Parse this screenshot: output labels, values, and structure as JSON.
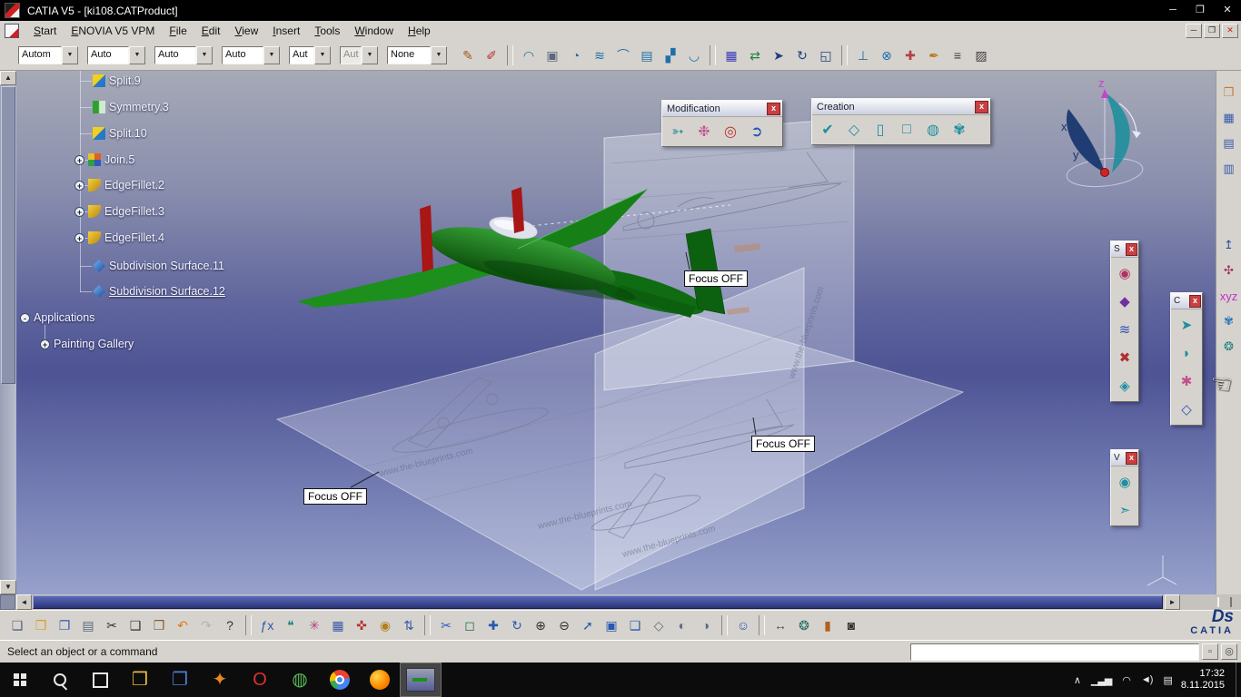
{
  "titlebar": {
    "title": "CATIA V5 - [ki108.CATProduct]",
    "minimize": "─",
    "restore": "❒",
    "close": "✕"
  },
  "menubar": {
    "items": [
      {
        "label": "Start"
      },
      {
        "label": "ENOVIA V5 VPM"
      },
      {
        "label": "File"
      },
      {
        "label": "Edit"
      },
      {
        "label": "View"
      },
      {
        "label": "Insert"
      },
      {
        "label": "Tools"
      },
      {
        "label": "Window"
      },
      {
        "label": "Help"
      }
    ],
    "minimize": "─",
    "restore": "❒",
    "close": "✕"
  },
  "filter_toolbar": {
    "dropdown_glyph": "▼",
    "combos": [
      {
        "value": "Autom"
      },
      {
        "value": "Auto"
      },
      {
        "value": "Auto"
      },
      {
        "value": "Auto"
      },
      {
        "value": "Aut"
      },
      {
        "value": "Aut"
      },
      {
        "value": "None"
      }
    ],
    "icons": [
      {
        "name": "paintbrush-icon",
        "glyph": "✎",
        "color": "#a05818"
      },
      {
        "name": "spray-brush-icon",
        "glyph": "✐",
        "color": "#b83030"
      },
      {
        "sep": true
      },
      {
        "name": "arc-curve-icon",
        "glyph": "◠",
        "color": "#1f6fa8"
      },
      {
        "name": "isometric-box-icon",
        "glyph": "▣",
        "color": "#5a6a7a"
      },
      {
        "name": "revolve-surface-icon",
        "glyph": "◔",
        "color": "#1f6fa8"
      },
      {
        "name": "offset-surface-icon",
        "glyph": "≋",
        "color": "#1f6fa8"
      },
      {
        "name": "sweep-surface-icon",
        "glyph": "⌒",
        "color": "#1f6fa8"
      },
      {
        "name": "fill-surface-icon",
        "glyph": "▤",
        "color": "#1f6fa8"
      },
      {
        "name": "loft-surface-icon",
        "glyph": "▞",
        "color": "#1f6fa8"
      },
      {
        "name": "blend-surface-icon",
        "glyph": "◡",
        "color": "#1f6fa8"
      },
      {
        "sep": true
      },
      {
        "name": "uv-grid-icon",
        "glyph": "▦",
        "color": "#3a3ab8"
      },
      {
        "name": "symmetry-transform-icon",
        "glyph": "⇄",
        "color": "#1f8040"
      },
      {
        "name": "translate-icon",
        "glyph": "➤",
        "color": "#20407f"
      },
      {
        "name": "rotate-icon",
        "glyph": "↻",
        "color": "#20407f"
      },
      {
        "name": "scale-icon",
        "glyph": "◱",
        "color": "#20407f"
      },
      {
        "sep": true
      },
      {
        "name": "projection-icon",
        "glyph": "⊥",
        "color": "#1f6fa8"
      },
      {
        "name": "intersection-icon",
        "glyph": "⊗",
        "color": "#1f6fa8"
      },
      {
        "name": "healing-icon",
        "glyph": "✚",
        "color": "#b84040"
      },
      {
        "name": "pen-icon",
        "glyph": "✒",
        "color": "#b87818"
      },
      {
        "name": "stacking-icon",
        "glyph": "≡",
        "color": "#404040"
      },
      {
        "name": "hatching-icon",
        "glyph": "▨",
        "color": "#404040"
      }
    ]
  },
  "tree": {
    "items": [
      {
        "label": "Split.9"
      },
      {
        "label": "Symmetry.3"
      },
      {
        "label": "Split.10"
      },
      {
        "label": "Join.5",
        "expander": "+"
      },
      {
        "label": "EdgeFillet.2",
        "expander": "+"
      },
      {
        "label": "EdgeFillet.3",
        "expander": "+"
      },
      {
        "label": "EdgeFillet.4",
        "expander": "+"
      },
      {
        "label": "Subdivision Surface.11"
      },
      {
        "label": "Subdivision Surface.12"
      },
      {
        "label": "Applications",
        "expander": "-"
      },
      {
        "label": "Painting Gallery",
        "expander": "+"
      }
    ]
  },
  "viewport": {
    "focus_off_labels": [
      "Focus OFF",
      "Focus OFF",
      "Focus OFF"
    ],
    "watermark": "www.the-blueprints.com",
    "compass": {
      "x": "x",
      "y": "y",
      "z": "z"
    }
  },
  "panels": {
    "modification": {
      "title": "Modification",
      "close_label": "x",
      "icons": [
        {
          "name": "modification-curve-icon",
          "glyph": "➳",
          "color": "#1f8f9f"
        },
        {
          "name": "attraction-icon",
          "glyph": "❉",
          "color": "#c05090"
        },
        {
          "name": "erase-icon",
          "glyph": "◎",
          "color": "#c03030"
        },
        {
          "name": "revert-icon",
          "glyph": "➲",
          "color": "#2858b0"
        }
      ]
    },
    "creation": {
      "title": "Creation",
      "close_label": "x",
      "icons": [
        {
          "name": "create-curve-icon",
          "glyph": "✔",
          "color": "#1f8f9f"
        },
        {
          "name": "create-surface-icon",
          "glyph": "◇",
          "color": "#1f8f9f"
        },
        {
          "name": "create-cylinder-icon",
          "glyph": "▯",
          "color": "#1f8f9f"
        },
        {
          "name": "create-box-icon",
          "glyph": "□",
          "color": "#1f8f9f"
        },
        {
          "name": "create-sphere-icon",
          "glyph": "◍",
          "color": "#1f8f9f"
        },
        {
          "name": "create-swirl-icon",
          "glyph": "✾",
          "color": "#1f8f9f"
        }
      ]
    },
    "s_toolbar": {
      "title": "S",
      "close_label": "x",
      "icons": [
        {
          "name": "subdivision-sphere-icon",
          "glyph": "◉",
          "color": "#b03060"
        },
        {
          "name": "subdivision-cube-icon",
          "glyph": "◆",
          "color": "#7030a0"
        },
        {
          "name": "subdivision-pipe-icon",
          "glyph": "≋",
          "color": "#3050b0"
        },
        {
          "name": "subdivision-cut-icon",
          "glyph": "✖",
          "color": "#b03030"
        },
        {
          "name": "subdivision-box-icon",
          "glyph": "◈",
          "color": "#1f8f9f"
        }
      ]
    },
    "c_toolbar": {
      "title": "C",
      "close_label": "x",
      "icons": [
        {
          "name": "curve-edit-icon",
          "glyph": "➤",
          "color": "#1f8f9f"
        },
        {
          "name": "surface-edit-icon",
          "glyph": "◗",
          "color": "#1f8f9f"
        },
        {
          "name": "control-points-icon",
          "glyph": "✱",
          "color": "#c05090"
        },
        {
          "name": "cage-icon",
          "glyph": "◇",
          "color": "#3050b0"
        }
      ]
    },
    "v_toolbar": {
      "title": "V",
      "close_label": "x",
      "icons": [
        {
          "name": "visualization-eye-icon",
          "glyph": "◉",
          "color": "#1f8f9f"
        },
        {
          "name": "visualization-arrow-icon",
          "glyph": "➣",
          "color": "#1f8f9f"
        }
      ]
    }
  },
  "right_dock": {
    "icons": [
      {
        "name": "catalog-icon",
        "glyph": "❒",
        "color": "#c87830"
      },
      {
        "name": "design-table-icon",
        "glyph": "▦",
        "color": "#3858a8"
      },
      {
        "name": "spreadsheet-icon",
        "glyph": "▤",
        "color": "#3858a8"
      },
      {
        "name": "report-icon",
        "glyph": "▥",
        "color": "#3858a8"
      },
      {
        "name": "exit-workbench-icon",
        "glyph": "↥",
        "color": "#3050a0",
        "gap": true
      },
      {
        "name": "pin-icon",
        "glyph": "✣",
        "color": "#a03060"
      },
      {
        "name": "xyz-axes-icon",
        "glyph": "xyz",
        "color": "#c030c0"
      },
      {
        "name": "swirl-tool-icon",
        "glyph": "✾",
        "color": "#2878b8"
      },
      {
        "name": "globe-icon",
        "glyph": "❂",
        "color": "#208080"
      }
    ]
  },
  "bottom_toolbar": {
    "icons": [
      {
        "name": "new-document-icon",
        "glyph": "❏",
        "color": "#50607a"
      },
      {
        "name": "open-folder-icon",
        "glyph": "❒",
        "color": "#d8a020"
      },
      {
        "name": "save-icon",
        "glyph": "❐",
        "color": "#3858b0"
      },
      {
        "name": "print-icon",
        "glyph": "▤",
        "color": "#5a6a7a"
      },
      {
        "name": "cut-icon",
        "glyph": "✂",
        "color": "#303030"
      },
      {
        "name": "copy-icon",
        "glyph": "❑",
        "color": "#303030"
      },
      {
        "name": "paste-icon",
        "glyph": "❒",
        "color": "#806040"
      },
      {
        "name": "undo-icon",
        "glyph": "↶",
        "color": "#e07818"
      },
      {
        "name": "redo-icon",
        "glyph": "↷",
        "color": "#9a9a94",
        "disabled": true
      },
      {
        "name": "context-help-icon",
        "glyph": "?",
        "color": "#303030"
      },
      {
        "sep": true
      },
      {
        "name": "formula-icon",
        "glyph": "ƒx",
        "color": "#2858b0"
      },
      {
        "name": "comment-icon",
        "glyph": "❝",
        "color": "#1f8080"
      },
      {
        "name": "knowledge-icon",
        "glyph": "✳",
        "color": "#b04080"
      },
      {
        "name": "knowledge-table-icon",
        "glyph": "▦",
        "color": "#3858a8"
      },
      {
        "name": "axis-system-icon",
        "glyph": "✜",
        "color": "#b03030"
      },
      {
        "name": "lock-icon",
        "glyph": "◉",
        "color": "#b08020"
      },
      {
        "name": "sort-icon",
        "glyph": "⇅",
        "color": "#3858a8"
      },
      {
        "sep": true
      },
      {
        "name": "section-cut-icon",
        "glyph": "✂",
        "color": "#2858c0"
      },
      {
        "name": "selection-frame-icon",
        "glyph": "◻",
        "color": "#1f7040"
      },
      {
        "name": "pan-icon",
        "glyph": "✚",
        "color": "#2858b0"
      },
      {
        "name": "rotate-view-icon",
        "glyph": "↻",
        "color": "#2858b0"
      },
      {
        "name": "zoom-in-icon",
        "glyph": "⊕",
        "color": "#303030"
      },
      {
        "name": "zoom-out-icon",
        "glyph": "⊖",
        "color": "#303030"
      },
      {
        "name": "fly-mode-icon",
        "glyph": "➚",
        "color": "#2858b0"
      },
      {
        "name": "fit-all-icon",
        "glyph": "▣",
        "color": "#2858b0"
      },
      {
        "name": "multi-view-icon",
        "glyph": "❏",
        "color": "#2858b0"
      },
      {
        "name": "iso-view-icon",
        "glyph": "◇",
        "color": "#5a6a7a"
      },
      {
        "name": "shading-mode-icon",
        "glyph": "◐",
        "color": "#5a6a7a"
      },
      {
        "name": "hide-show-icon",
        "glyph": "◑",
        "color": "#5a6a7a"
      },
      {
        "sep": true
      },
      {
        "name": "user-icon",
        "glyph": "☺",
        "color": "#2858b0"
      },
      {
        "sep": true
      },
      {
        "name": "measure-icon",
        "glyph": "↔",
        "color": "#505050"
      },
      {
        "name": "globe-mode-icon",
        "glyph": "❂",
        "color": "#1f7060"
      },
      {
        "name": "gauge-icon",
        "glyph": "▮",
        "color": "#b06020"
      },
      {
        "name": "camera-icon",
        "glyph": "◙",
        "color": "#303030"
      }
    ]
  },
  "scrollbars": {
    "up": "▲",
    "down": "▼",
    "left": "◄",
    "right": "►"
  },
  "statusbar": {
    "message": "Select an object or a command",
    "input_value": "",
    "list_button_glyph": "▫",
    "power_input_glyph": "◎"
  },
  "branding": {
    "ds": "Ds",
    "name": "CATIA"
  },
  "taskbar": {
    "apps": [
      {
        "name": "file-explorer-icon",
        "glyph": "❒",
        "color": "#e8b93e"
      },
      {
        "name": "document-app-icon",
        "glyph": "❐",
        "color": "#4a7fd4"
      },
      {
        "name": "utility-app-icon",
        "glyph": "✦",
        "color": "#e88820"
      },
      {
        "name": "opera-icon",
        "glyph": "O",
        "color": "#e03030"
      },
      {
        "name": "green-app-icon",
        "glyph": "◍",
        "color": "#58b858"
      },
      {
        "name": "chrome-icon",
        "glyph": "",
        "kind": "chrome"
      },
      {
        "name": "firefox-icon",
        "glyph": "",
        "kind": "firefox"
      },
      {
        "name": "catia-taskbar-icon",
        "glyph": "",
        "kind": "catia",
        "active": true
      }
    ],
    "tray": [
      {
        "name": "hidden-icons-chevron",
        "glyph": "∧"
      },
      {
        "name": "network-icon",
        "glyph": "▁▃▅"
      },
      {
        "name": "wifi-icon",
        "glyph": "◠"
      },
      {
        "name": "volume-icon",
        "glyph": "◄)"
      },
      {
        "name": "keyboard-icon",
        "glyph": "▤"
      }
    ],
    "clock": {
      "time": "17:32",
      "date": "8.11.2015"
    }
  }
}
